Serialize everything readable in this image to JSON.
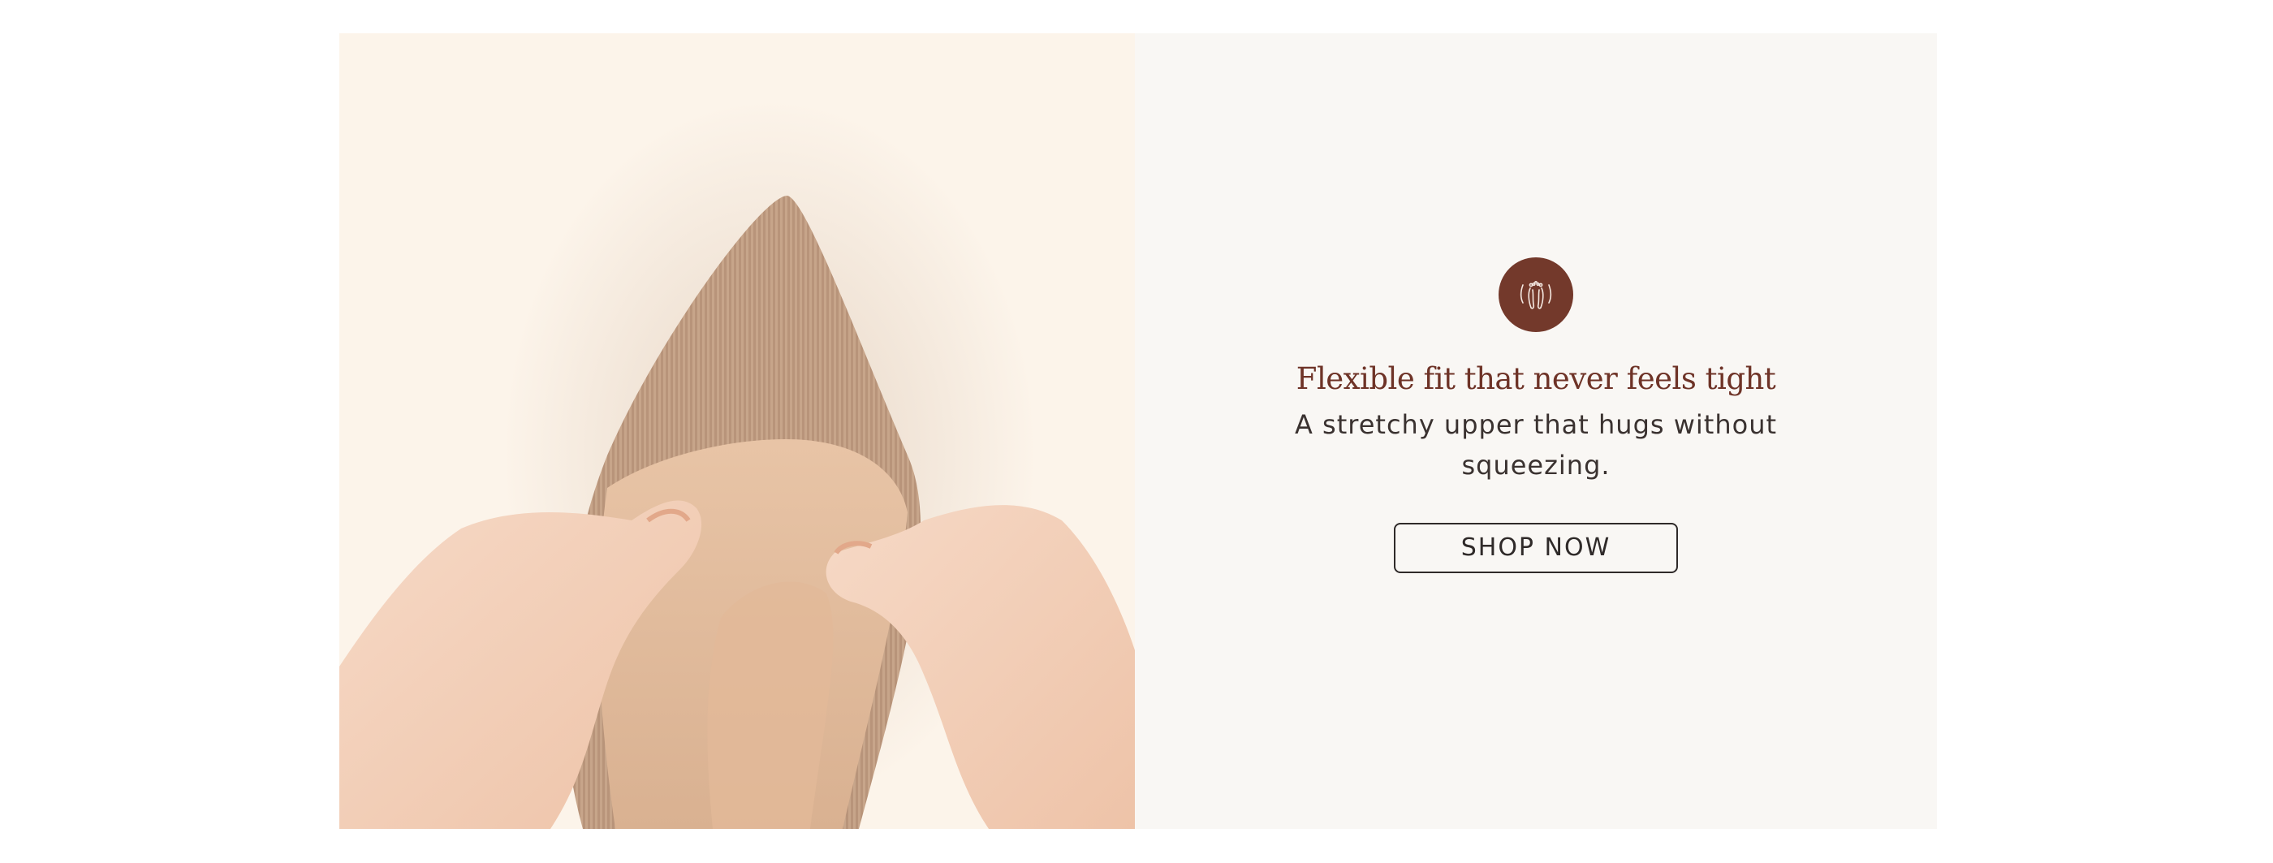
{
  "feature": {
    "icon": "feet-icon",
    "headline": "Flexible fit that never feels tight",
    "description": "A stretchy upper that hugs without squeezing.",
    "cta_label": "SHOP NOW"
  },
  "media": {
    "image_subject": "hands-stretching-knit-shoe"
  },
  "colors": {
    "accent": "#73392b",
    "headline": "#6e3327",
    "panel_background": "#f9f7f4"
  }
}
